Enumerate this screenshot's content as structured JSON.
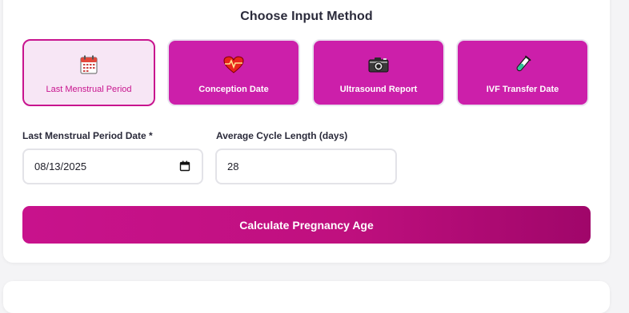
{
  "heading": "Choose Input Method",
  "methods": [
    {
      "label": "Last Menstrual Period",
      "icon": "calendar-icon",
      "active": true
    },
    {
      "label": "Conception Date",
      "icon": "heart-pulse-icon",
      "active": false
    },
    {
      "label": "Ultrasound Report",
      "icon": "camera-icon",
      "active": false
    },
    {
      "label": "IVF Transfer Date",
      "icon": "test-tube-icon",
      "active": false
    }
  ],
  "fields": {
    "lmp_label": "Last Menstrual Period Date *",
    "lmp_value": "08/13/2025",
    "cycle_label": "Average Cycle Length (days)",
    "cycle_value": "28"
  },
  "calculate_label": "Calculate Pregnancy Age",
  "colors": {
    "accent": "#c8148e",
    "method_bg": "#cc1faa",
    "active_bg": "#f7e6f5"
  }
}
